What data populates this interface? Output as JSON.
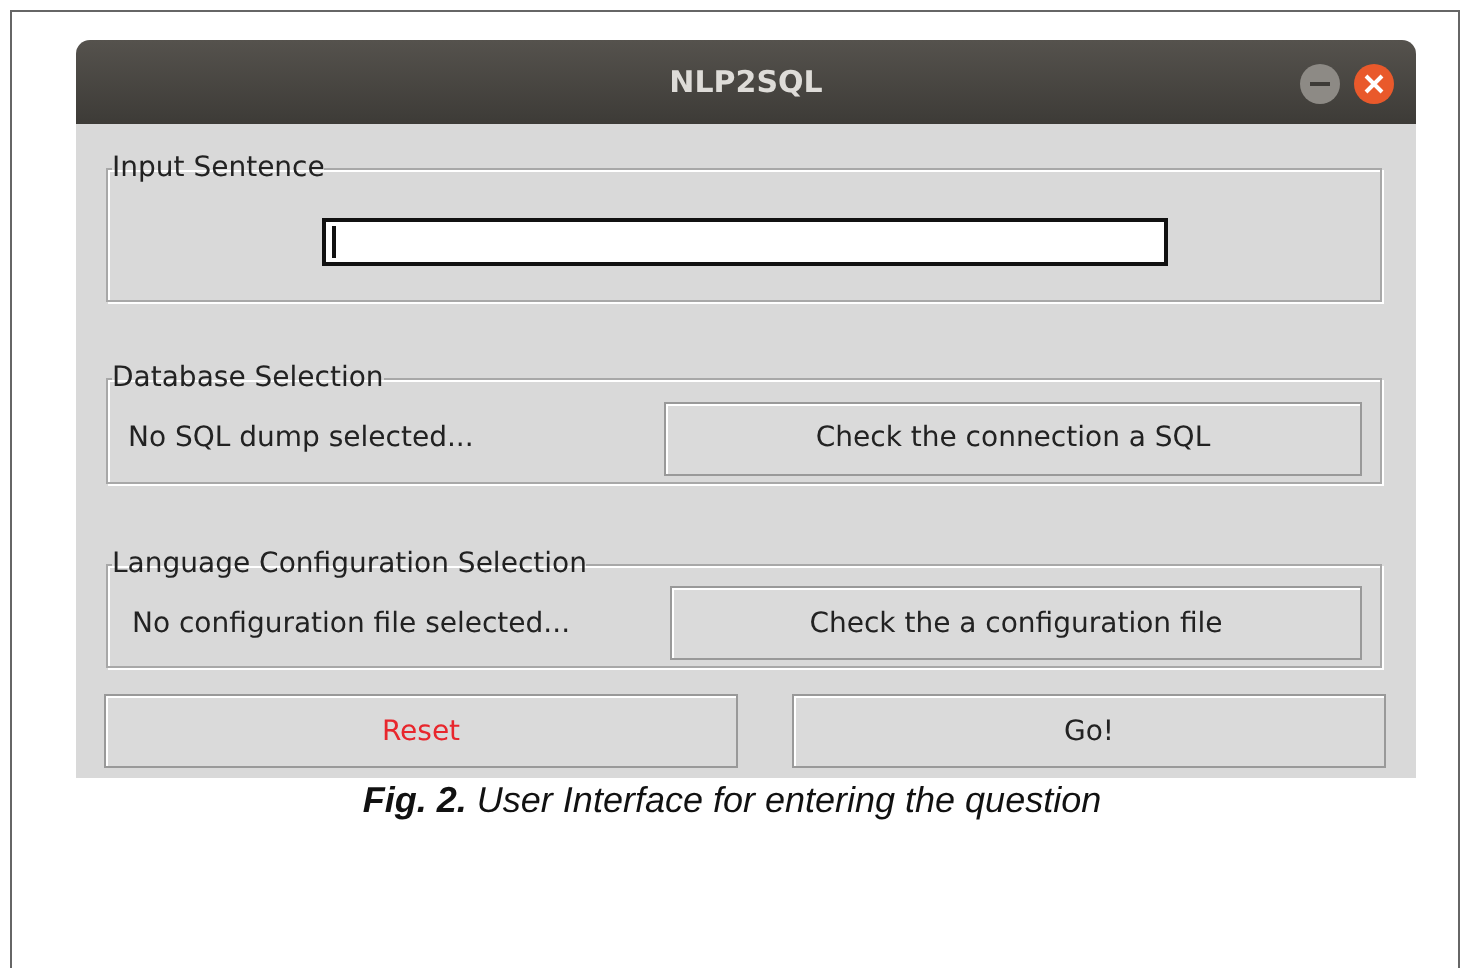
{
  "window": {
    "title": "NLP2SQL"
  },
  "input_group": {
    "title": "Input Sentence",
    "field": {
      "focused": true
    }
  },
  "database_group": {
    "title": "Database Selection",
    "status": "No SQL dump selected...",
    "button": "Check the connection a SQL"
  },
  "language_group": {
    "title": "Language Configuration Selection",
    "status": "No configuration file selected...",
    "button": "Check the a configuration file"
  },
  "buttons": [
    {
      "label": "Reset",
      "color": "#e8262c"
    },
    {
      "label": "Go!",
      "color": "#222222"
    }
  ],
  "caption": {
    "label": "Fig. 2.",
    "text": "User Interface for entering the question"
  }
}
